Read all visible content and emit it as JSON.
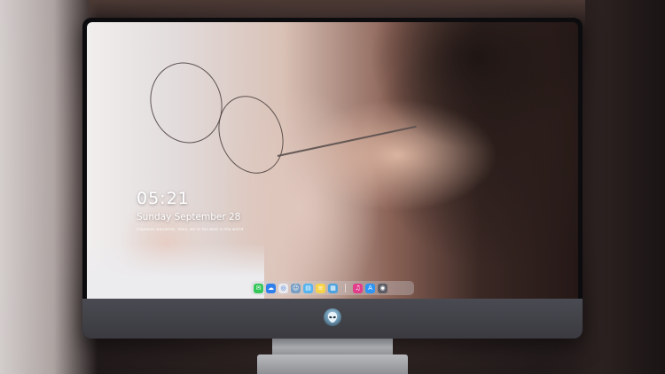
{
  "lock_screen": {
    "time": "05:21",
    "date": "Sunday September 28",
    "subline": "Hopeless wanderer, stars, we're the best in the world"
  },
  "dock": {
    "left_apps": [
      {
        "icon": "messages-icon",
        "glyph": "✉",
        "color": "#34c759"
      },
      {
        "icon": "mail-icon",
        "glyph": "☁",
        "color": "#2f80ed"
      },
      {
        "icon": "safari-icon",
        "glyph": "◎",
        "color": "#e9e9ee"
      },
      {
        "icon": "finder-icon",
        "glyph": "☺",
        "color": "#7a9fc4"
      },
      {
        "icon": "folder-icon",
        "glyph": "▤",
        "color": "#53b4f0"
      },
      {
        "icon": "notes-icon",
        "glyph": "≡",
        "color": "#f6d34a"
      },
      {
        "icon": "photos-icon",
        "glyph": "▦",
        "color": "#4ea3de"
      }
    ],
    "right_apps": [
      {
        "icon": "music-icon",
        "glyph": "♫",
        "color": "#e23c8a"
      },
      {
        "icon": "app-store-icon",
        "glyph": "A",
        "color": "#2f95f4"
      },
      {
        "icon": "camera-icon",
        "glyph": "◉",
        "color": "#5d5d66"
      }
    ]
  },
  "colors": {
    "bezel": "#0c0c0e",
    "chin": "#3a3a40",
    "stand": "#a9aaae"
  }
}
